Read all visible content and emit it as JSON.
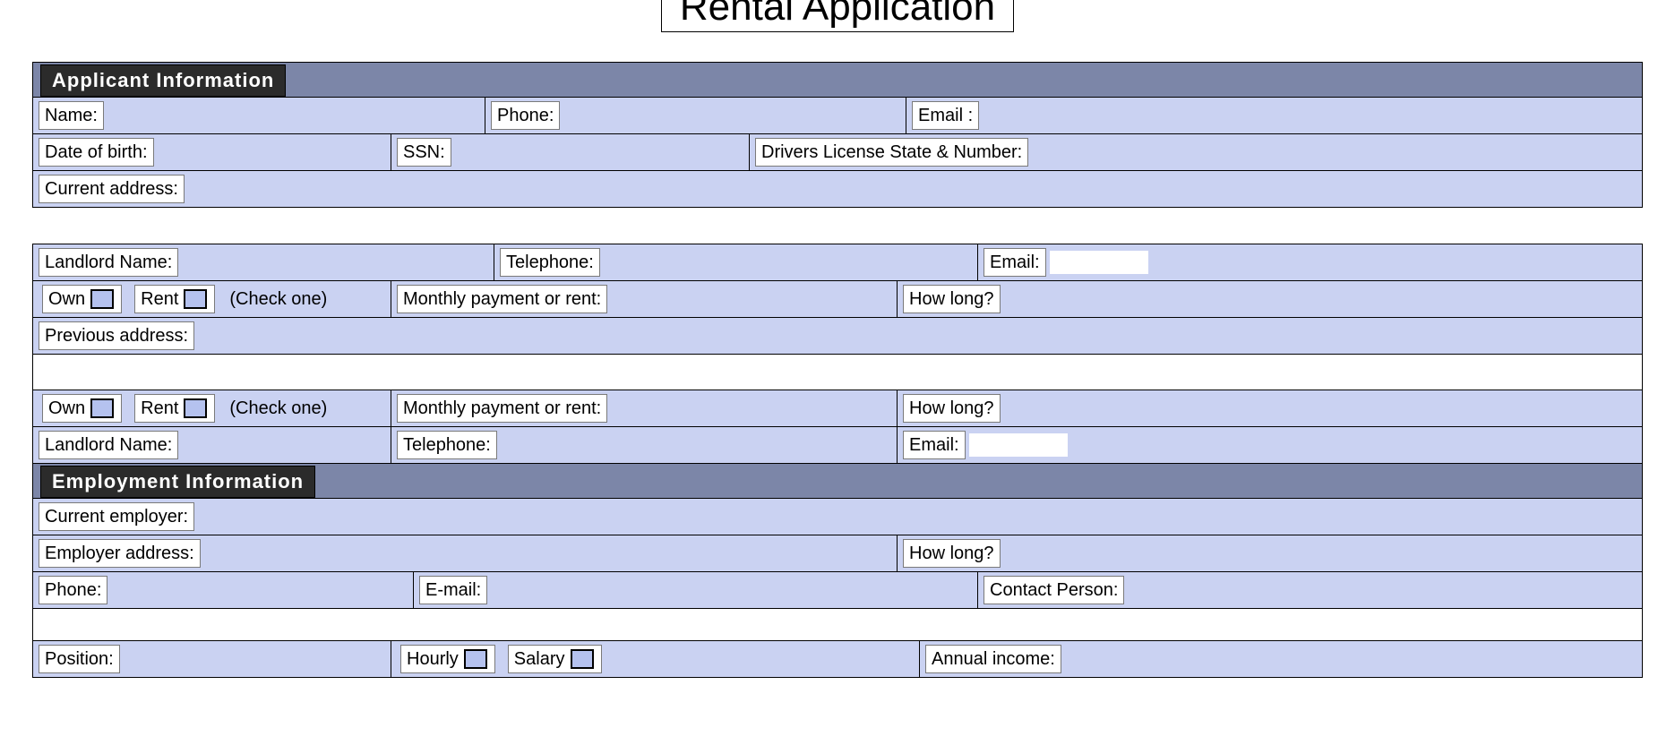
{
  "title": "Rental Application",
  "sections": {
    "applicant": {
      "header": "Applicant Information",
      "fields": {
        "name": "Name:",
        "phone": "Phone:",
        "email": "Email :",
        "dob": "Date of birth:",
        "ssn": "SSN:",
        "dl": "Drivers License State & Number:",
        "current_address": "Current address:"
      }
    },
    "residence": {
      "landlord_name": "Landlord Name:",
      "telephone": "Telephone:",
      "email": "Email:",
      "own": "Own",
      "rent": "Rent",
      "check_one": "(Check one)",
      "monthly": "Monthly payment or rent:",
      "how_long": "How long?",
      "previous_address": "Previous address:"
    },
    "employment": {
      "header": "Employment Information",
      "current_employer": "Current employer:",
      "employer_address": "Employer address:",
      "how_long": "How long?",
      "phone": "Phone:",
      "email": "E-mail:",
      "contact_person": "Contact Person:",
      "position": "Position:",
      "hourly": "Hourly",
      "salary": "Salary",
      "annual_income": "Annual income:"
    }
  }
}
